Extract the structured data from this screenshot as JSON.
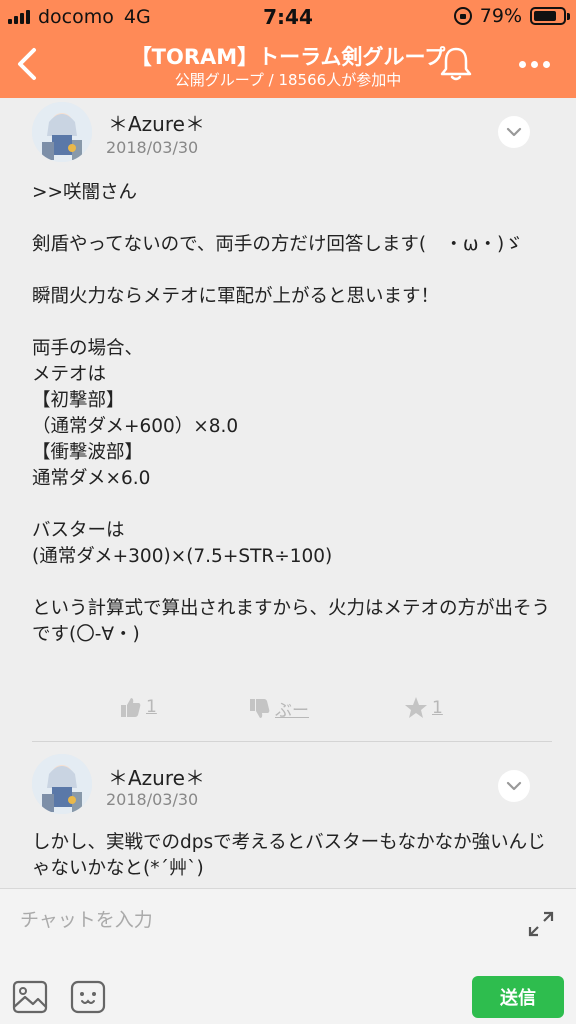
{
  "status_bar": {
    "carrier": "docomo",
    "network": "4G",
    "time": "7:44",
    "battery": "79%",
    "battery_level": 0.79
  },
  "header": {
    "title": "【TORAM】トーラム剣グループ",
    "subtitle": "公開グループ / 18566人が参加中"
  },
  "posts": [
    {
      "author": "＊Azure＊",
      "date": "2018/03/30",
      "body": ">>咲闇さん\n\n剣盾やってないので、両手の方だけ回答します(　・ω・)ゞ\n\n瞬間火力ならメテオに軍配が上がると思います！\n\n両手の場合、\nメテオは\n【初撃部】\n（通常ダメ+600）×8.0\n【衝撃波部】\n通常ダメ×6.0\n\nバスターは\n(通常ダメ+300)×(7.5+STR÷100)\n\nという計算式で算出されますから、火力はメテオの方が出そうです(〇-∀・)",
      "like_count": "1",
      "boo_label": "ぶー",
      "star_count": "1"
    },
    {
      "author": "＊Azure＊",
      "date": "2018/03/30",
      "body": "しかし、実戦でのdpsで考えるとバスターもなかなか強いんじゃないかなと(*´艸`)"
    }
  ],
  "composer": {
    "placeholder": "チャットを入力",
    "send_label": "送信"
  },
  "colors": {
    "header": "#ff8a57",
    "send": "#2ebd4e"
  }
}
